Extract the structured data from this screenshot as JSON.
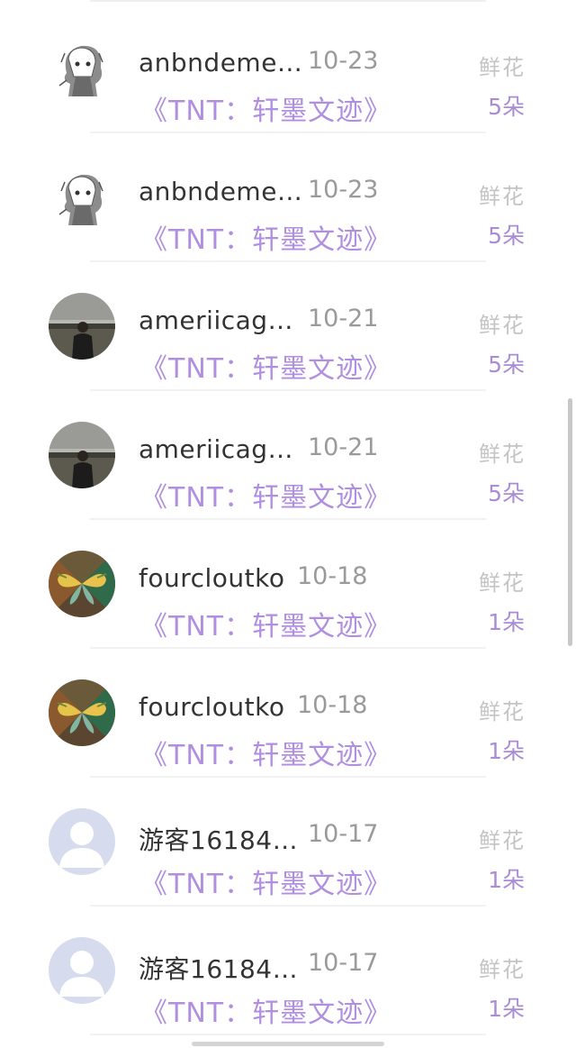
{
  "rows": [
    {
      "name": "anbndeme…",
      "date": "10-23",
      "label": "鲜花",
      "title": "《TNT：轩墨文迹》",
      "count": "5朵",
      "avatar": "sketch-girl-avatar"
    },
    {
      "name": "anbndeme…",
      "date": "10-23",
      "label": "鲜花",
      "title": "《TNT：轩墨文迹》",
      "count": "5朵",
      "avatar": "sketch-girl-avatar"
    },
    {
      "name": "ameriicag…",
      "date": "10-21",
      "label": "鲜花",
      "title": "《TNT：轩墨文迹》",
      "count": "5朵",
      "avatar": "landscape-person-avatar"
    },
    {
      "name": "ameriicag…",
      "date": "10-21",
      "label": "鲜花",
      "title": "《TNT：轩墨文迹》",
      "count": "5朵",
      "avatar": "landscape-person-avatar"
    },
    {
      "name": "fourcloutko",
      "date": "10-18",
      "label": "鲜花",
      "title": "《TNT：轩墨文迹》",
      "count": "1朵",
      "avatar": "butterfly-avatar"
    },
    {
      "name": "fourcloutko",
      "date": "10-18",
      "label": "鲜花",
      "title": "《TNT：轩墨文迹》",
      "count": "1朵",
      "avatar": "butterfly-avatar"
    },
    {
      "name": "游客16184…",
      "date": "10-17",
      "label": "鲜花",
      "title": "《TNT：轩墨文迹》",
      "count": "1朵",
      "avatar": "default-user-avatar"
    },
    {
      "name": "游客16184…",
      "date": "10-17",
      "label": "鲜花",
      "title": "《TNT：轩墨文迹》",
      "count": "1朵",
      "avatar": "default-user-avatar"
    }
  ],
  "colors": {
    "title": "#b08ee0",
    "count": "#a98bd6",
    "label": "#c4c4c4",
    "date": "#9a9a9a",
    "name": "#333333"
  }
}
